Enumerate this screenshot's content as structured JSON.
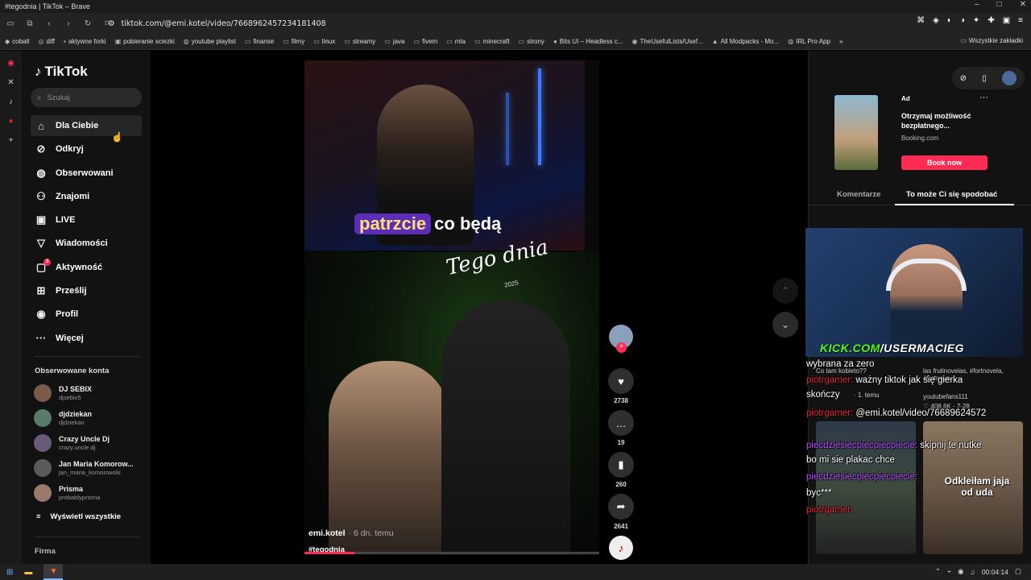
{
  "window": {
    "title": "#tegodnia | TikTok – Brave",
    "controls": [
      "–",
      "□",
      "✕"
    ]
  },
  "browser": {
    "url": "tiktok.com/@emi.kotel/video/7668962457234181408",
    "bookmarks": [
      {
        "label": "cobalt",
        "icon": "cobalt-icon"
      },
      {
        "label": "diff",
        "icon": "diff-icon"
      },
      {
        "label": "aktywne forki",
        "icon": "fork-icon"
      },
      {
        "label": "pobieranie sciezki",
        "icon": "download-icon"
      },
      {
        "label": "youtube playlist",
        "icon": "globe-icon"
      },
      {
        "label": "finanse",
        "icon": "folder-icon"
      },
      {
        "label": "filmy",
        "icon": "folder-icon"
      },
      {
        "label": "linux",
        "icon": "folder-icon"
      },
      {
        "label": "streamy",
        "icon": "folder-icon"
      },
      {
        "label": "java",
        "icon": "folder-icon"
      },
      {
        "label": "fivem",
        "icon": "folder-icon"
      },
      {
        "label": "mta",
        "icon": "folder-icon"
      },
      {
        "label": "minecraft",
        "icon": "folder-icon"
      },
      {
        "label": "strony",
        "icon": "folder-icon"
      },
      {
        "label": "Bits UI – Headless c...",
        "icon": "bits-icon"
      },
      {
        "label": "TheUsefulLists/Usef...",
        "icon": "github-icon"
      },
      {
        "label": "All Modpacks - Mo...",
        "icon": "modpack-icon"
      },
      {
        "label": "IRL Pro App",
        "icon": "globe-icon"
      }
    ],
    "bookmarks_more": "»",
    "bookmarks_all": "Wszystkie zakładki"
  },
  "sidebar": {
    "logo": "TikTok",
    "search_placeholder": "Szukaj",
    "nav": [
      {
        "label": "Dla Ciebie",
        "icon": "home-icon",
        "active": true
      },
      {
        "label": "Odkryj",
        "icon": "compass-icon"
      },
      {
        "label": "Obserwowani",
        "icon": "following-avatar-icon"
      },
      {
        "label": "Znajomi",
        "icon": "friends-icon"
      },
      {
        "label": "LIVE",
        "icon": "live-tv-icon"
      },
      {
        "label": "Wiadomości",
        "icon": "send-icon"
      },
      {
        "label": "Aktywność",
        "icon": "inbox-icon",
        "badge": "3"
      },
      {
        "label": "Prześlij",
        "icon": "upload-plus-icon"
      },
      {
        "label": "Profil",
        "icon": "profile-avatar-icon"
      },
      {
        "label": "Więcej",
        "icon": "more-dots-icon"
      }
    ],
    "followed_title": "Obserwowane konta",
    "accounts": [
      {
        "name": "DJ SEBIX",
        "handle": "djsebix5"
      },
      {
        "name": "djdziekan",
        "handle": "djdziekan"
      },
      {
        "name": "Crazy Uncle Dj",
        "handle": "crazy.uncle.dj"
      },
      {
        "name": "Jan Maria Komorow...",
        "handle": "jan_maria_komorowski"
      },
      {
        "name": "Prisma",
        "handle": "probablyprisma"
      }
    ],
    "show_all": "Wyświetl wszystkie",
    "footer": "Firma"
  },
  "video": {
    "caption_highlight": "patrzcie",
    "caption_rest": "co będą",
    "overlay_title": "Tego dnia",
    "overlay_year": "2025",
    "author": "emi.kotel",
    "posted": "· 6 dn. temu",
    "hashtag": "#tegodnia",
    "progress": 0.17
  },
  "actions": {
    "likes": "2738",
    "comments": "19",
    "saves": "260",
    "shares": "2641"
  },
  "right_panel": {
    "ad_label": "Ad",
    "ad_more": "···",
    "ad_title": "Otrzymaj możliwość bezpłatnego...",
    "ad_source": "Booking.com",
    "ad_button": "Book now",
    "tab_comments": "Komentarze",
    "tab_suggested": "To może Ci się spodobać"
  },
  "stream_overlay": {
    "kick_prefix": "KICK.COM",
    "kick_user": "/USERMACIEG",
    "chat": [
      {
        "user": "",
        "text": "wybrana za zero"
      },
      {
        "user": "piotrgamer:",
        "text": " ważny tiktok jak się gierka"
      },
      {
        "user": "",
        "text": "skończy"
      },
      {
        "user": "piotrgamer:",
        "text": " @emi.kotel/video/76689624572"
      },
      {
        "user": "piecdziesiecpiecpiecpiecie:",
        "text": " skipnij te nutke"
      },
      {
        "user": "",
        "text": "bo mi sie plakac chce"
      },
      {
        "user": "piecdziesiecpiecpiecpiecie:",
        "text": ""
      },
      {
        "user": "",
        "text": "byc***"
      },
      {
        "user": "piotrgamer:",
        "text": ""
      }
    ],
    "grid_meta_left": "Co tam kobieto??",
    "grid_meta_left_time": "· 1. temu",
    "grid_meta_right": "las frutinovelas, #fortnovela, #fortnove...",
    "grid_meta_right_user": "youtubefans111",
    "grid_meta_right_stats": "♡ 408.6K · 7-28",
    "grid_right_caption": "Odkleiłam jaja od uda"
  },
  "taskbar": {
    "time": "00:04:14"
  }
}
